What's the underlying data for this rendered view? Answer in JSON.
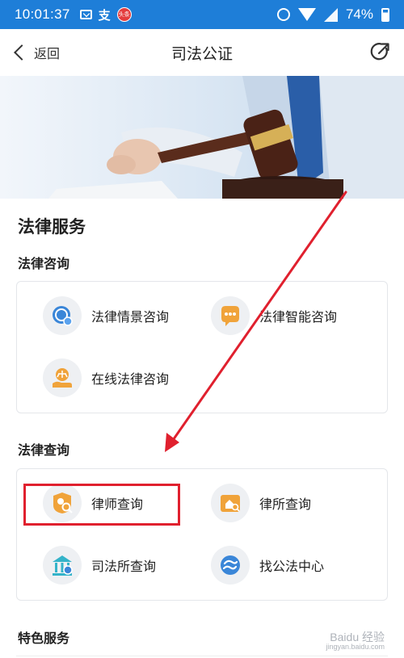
{
  "status_bar": {
    "time": "10:01:37",
    "battery": "74%",
    "news_badge": "头条",
    "alipay_glyph": "支",
    "icons": [
      "mail-icon",
      "alipay-icon",
      "news-app-icon",
      "alarm-icon",
      "wifi-icon",
      "signal-icon",
      "battery-icon"
    ]
  },
  "nav": {
    "back_label": "返回",
    "title": "司法公证",
    "share_icon": "share-icon"
  },
  "main": {
    "section_title": "法律服务",
    "groups": [
      {
        "title": "法律咨询",
        "items": [
          {
            "label": "法律情景咨询",
            "icon": "chat-bubble-icon"
          },
          {
            "label": "法律智能咨询",
            "icon": "dots-bubble-icon"
          },
          {
            "label": "在线法律咨询",
            "icon": "hand-justice-icon"
          }
        ]
      },
      {
        "title": "法律查询",
        "items": [
          {
            "label": "律师查询",
            "icon": "lawyer-search-icon"
          },
          {
            "label": "律所查询",
            "icon": "law-firm-search-icon"
          },
          {
            "label": "司法所查询",
            "icon": "court-building-icon"
          },
          {
            "label": "找公法中心",
            "icon": "notary-center-icon"
          }
        ]
      }
    ],
    "next_group_title": "特色服务"
  },
  "annotation": {
    "highlight_color": "#e0202e",
    "arrow_color": "#e0202e"
  },
  "watermark": {
    "text": "Baidu 经验",
    "sub": "jingyan.baidu.com"
  },
  "colors": {
    "status_bar": "#1e7ed8",
    "icon_blue": "#3a86d8",
    "icon_orange": "#f0a33a",
    "icon_teal": "#34b3c9"
  }
}
